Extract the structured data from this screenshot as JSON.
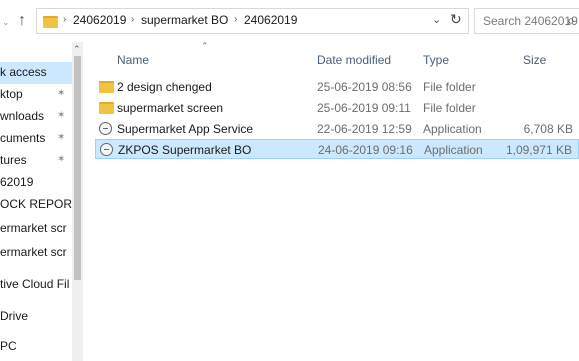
{
  "address_bar": {
    "recent_glyph": "⌄",
    "up_glyph": "↑",
    "separator": "›",
    "segments": [
      "24062019",
      "supermarket BO",
      "24062019"
    ],
    "dropdown_glyph": "⌄",
    "refresh_glyph": "↻"
  },
  "search": {
    "placeholder": "Search 24062019",
    "icon_glyph": "⌕"
  },
  "nav_pane": {
    "scroll_up_glyph": "⌃",
    "pin_glyph": "✶",
    "items": [
      {
        "label": "k access"
      },
      {
        "label": "ktop"
      },
      {
        "label": "wnloads"
      },
      {
        "label": "cuments"
      },
      {
        "label": "tures"
      },
      {
        "label": "62019"
      },
      {
        "label": "OCK REPORT"
      },
      {
        "label": "ermarket scr"
      },
      {
        "label": "ermarket scr"
      },
      {
        "label": "tive Cloud Fil"
      },
      {
        "label": "Drive"
      },
      {
        "label": "PC"
      }
    ]
  },
  "file_list": {
    "sort_glyph": "⌃",
    "columns": {
      "name": "Name",
      "date": "Date modified",
      "type": "Type",
      "size": "Size"
    },
    "rows": [
      {
        "icon": "folder-icon",
        "name": "2 design chenged",
        "date": "25-06-2019 08:56",
        "type": "File folder",
        "size": ""
      },
      {
        "icon": "folder-icon",
        "name": "supermarket screen",
        "date": "25-06-2019 09:11",
        "type": "File folder",
        "size": ""
      },
      {
        "icon": "application-icon",
        "name": "Supermarket App Service",
        "date": "22-06-2019 12:59",
        "type": "Application",
        "size": "6,708 KB"
      },
      {
        "icon": "application-icon",
        "name": "ZKPOS Supermarket BO",
        "date": "24-06-2019 09:16",
        "type": "Application",
        "size": "1,09,971 KB"
      }
    ]
  },
  "colors": {
    "selection_bg": "#cce8ff",
    "selection_border": "#99d1ff",
    "folder": "#f1c343",
    "header_text": "#4c607a"
  }
}
